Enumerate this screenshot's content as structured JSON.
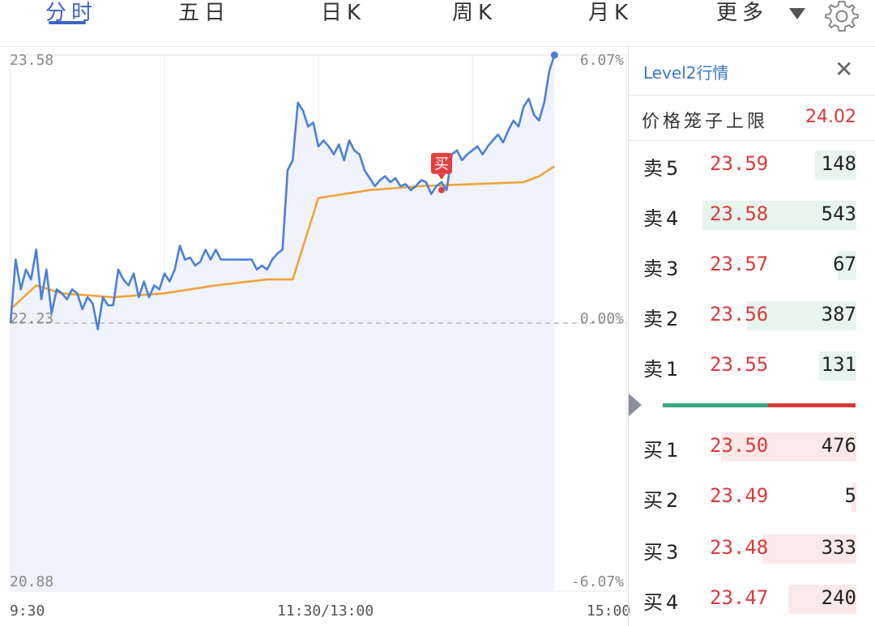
{
  "tabs": [
    {
      "label": "分时",
      "active": true
    },
    {
      "label": "五日",
      "active": false
    },
    {
      "label": "日K",
      "active": false
    },
    {
      "label": "周K",
      "active": false
    },
    {
      "label": "月K",
      "active": false
    },
    {
      "label": "更多",
      "active": false
    }
  ],
  "icons": {
    "more": "triangle-down-icon",
    "settings": "gear-icon"
  },
  "chart": {
    "price_high": "23.58",
    "price_base": "22.23",
    "price_low": "20.88",
    "pct_high": "6.07%",
    "pct_base": "0.00%",
    "pct_low": "-6.07%",
    "time_start": "9:30",
    "time_mid": "11:30/13:00",
    "time_end": "15:00",
    "buy_marker": "买",
    "colors": {
      "price_line": "#4a80d8",
      "avg_line": "#eea43a",
      "fill": "#eef2fb",
      "buy_marker": "#e2403f"
    }
  },
  "chart_data": {
    "type": "line",
    "x_unit": "trading minutes since 9:30 (0–240)",
    "ylim": [
      20.88,
      23.58
    ],
    "base_price": 22.23,
    "series": [
      {
        "values_x": [
          0,
          2,
          4,
          6,
          8,
          10,
          12,
          14,
          16,
          18,
          20,
          22,
          24,
          26,
          28,
          30,
          32,
          34,
          36,
          38,
          40,
          42,
          44,
          46,
          48,
          50,
          52,
          54,
          56,
          58,
          60,
          62,
          64,
          66,
          68,
          70,
          72,
          74,
          76,
          78,
          80,
          82,
          84,
          86,
          88,
          90,
          92,
          94,
          96,
          98,
          100,
          102,
          104,
          106,
          108,
          110,
          112,
          114,
          116,
          118,
          120,
          122,
          124,
          126,
          128,
          130,
          132,
          134,
          136,
          138,
          140,
          142,
          144,
          146,
          148,
          150,
          152,
          154,
          156,
          158,
          160,
          162,
          164,
          166,
          168,
          170,
          172,
          174,
          176,
          178,
          180,
          182,
          184,
          186,
          188,
          190,
          192,
          194,
          196,
          198,
          200,
          202,
          204,
          206,
          208,
          210,
          212
        ],
        "values_y": [
          22.23,
          22.55,
          22.4,
          22.5,
          22.45,
          22.6,
          22.35,
          22.5,
          22.28,
          22.4,
          22.38,
          22.35,
          22.4,
          22.38,
          22.3,
          22.36,
          22.33,
          22.2,
          22.36,
          22.32,
          22.32,
          22.5,
          22.45,
          22.42,
          22.48,
          22.36,
          22.44,
          22.36,
          22.42,
          22.4,
          22.48,
          22.44,
          22.5,
          22.62,
          22.55,
          22.56,
          22.52,
          22.54,
          22.6,
          22.55,
          22.6,
          22.55,
          22.55,
          22.55,
          22.55,
          22.55,
          22.55,
          22.55,
          22.5,
          22.52,
          22.5,
          22.55,
          22.58,
          22.6,
          23.0,
          23.05,
          23.34,
          23.3,
          23.22,
          23.24,
          23.12,
          23.15,
          23.12,
          23.08,
          23.13,
          23.05,
          23.15,
          23.1,
          23.08,
          23.0,
          22.96,
          22.92,
          22.95,
          22.97,
          22.94,
          22.96,
          22.92,
          22.93,
          22.9,
          22.92,
          22.95,
          22.94,
          22.88,
          22.92,
          22.94,
          22.9,
          23.08,
          23.1,
          23.05,
          23.08,
          23.1,
          23.12,
          23.08,
          23.12,
          23.15,
          23.18,
          23.14,
          23.2,
          23.25,
          23.22,
          23.32,
          23.36,
          23.28,
          23.25,
          23.34,
          23.5,
          23.58
        ]
      },
      {
        "values_x": [
          0,
          10,
          20,
          40,
          60,
          80,
          100,
          110,
          120,
          140,
          160,
          180,
          200,
          206,
          212
        ],
        "values_y": [
          22.3,
          22.42,
          22.38,
          22.36,
          22.38,
          22.42,
          22.45,
          22.45,
          22.86,
          22.9,
          22.92,
          22.93,
          22.94,
          22.97,
          23.02
        ]
      }
    ],
    "buy_marker_at": {
      "x": 168,
      "y": 22.9
    }
  },
  "level2": {
    "title": "Level2行情",
    "close_label": "✕",
    "limit_label": "价格笼子上限",
    "limit_value": "24.02",
    "sells": [
      {
        "label": "卖5",
        "price": "23.59",
        "volume": "148",
        "fill": 0.27
      },
      {
        "label": "卖4",
        "price": "23.58",
        "volume": "543",
        "fill": 1.0
      },
      {
        "label": "卖3",
        "price": "23.57",
        "volume": "67",
        "fill": 0.12
      },
      {
        "label": "卖2",
        "price": "23.56",
        "volume": "387",
        "fill": 0.71
      },
      {
        "label": "卖1",
        "price": "23.55",
        "volume": "131",
        "fill": 0.24
      }
    ],
    "buys": [
      {
        "label": "买1",
        "price": "23.50",
        "volume": "476",
        "fill": 0.88
      },
      {
        "label": "买2",
        "price": "23.49",
        "volume": "5",
        "fill": 0.01
      },
      {
        "label": "买3",
        "price": "23.48",
        "volume": "333",
        "fill": 0.61
      },
      {
        "label": "买4",
        "price": "23.47",
        "volume": "240",
        "fill": 0.44
      }
    ]
  }
}
